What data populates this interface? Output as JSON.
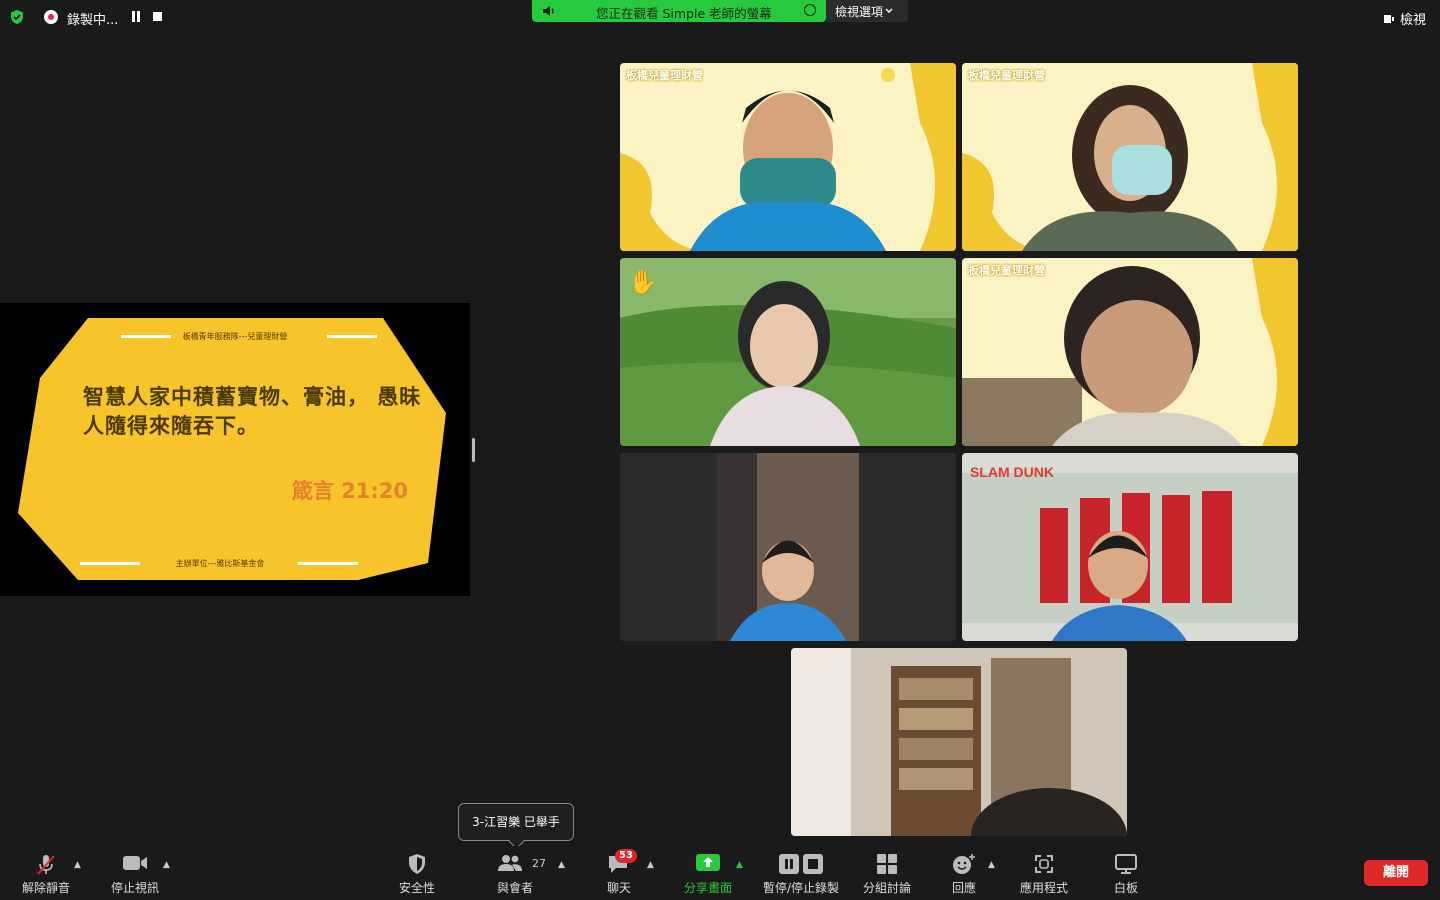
{
  "topbar": {
    "recording_label": "錄製中...",
    "share_banner": "您正在觀看 Simple 老師的螢幕",
    "view_options": "檢視選項",
    "view": "檢視"
  },
  "slide": {
    "header": "板橋青年服務隊---兒童理財營",
    "verse": "智ㄓˋ慧ㄏㄨㄟˋ人ㄖㄣˊ家ㄐㄧㄚ中ㄓㄨㄥ積ㄐㄧ蓄ㄒㄩˋ寶ㄅㄠˇ物ㄨˋ、膏ㄍㄠ油ㄧㄡˊ， 愚ㄩˊ昧ㄇㄟˋ人ㄖㄣˊ隨ㄙㄨㄟˊ得ㄉㄜˊ來ㄌㄞˊ隨ㄙㄨㄟˊ吞ㄊㄨㄣ下ㄒㄧㄚˋ。",
    "verse_display": "智慧人家中積蓄寶物、膏油， 愚昧人隨得來隨吞下。",
    "reference": "箴言 21:20",
    "footer": "主辦單位---雅比斯基金會"
  },
  "gallery": {
    "caption": "板橋兒童理財營"
  },
  "tooltip": "3-江習樂 已舉手",
  "toolbar": {
    "unmute": "解除靜音",
    "stop_video": "停止視訊",
    "security": "安全性",
    "participants": "與會者",
    "participants_count": "27",
    "chat": "聊天",
    "chat_badge": "53",
    "share_screen": "分享畫面",
    "pause_stop_recording": "暫停/停止錄製",
    "breakout": "分組討論",
    "reactions": "回應",
    "apps": "應用程式",
    "whiteboard": "白板",
    "leave": "離開"
  },
  "colors": {
    "share_green": "#27c93f",
    "leave_red": "#e02828",
    "slide_yellow": "#f7c52b",
    "active_border": "#2ad14a"
  }
}
